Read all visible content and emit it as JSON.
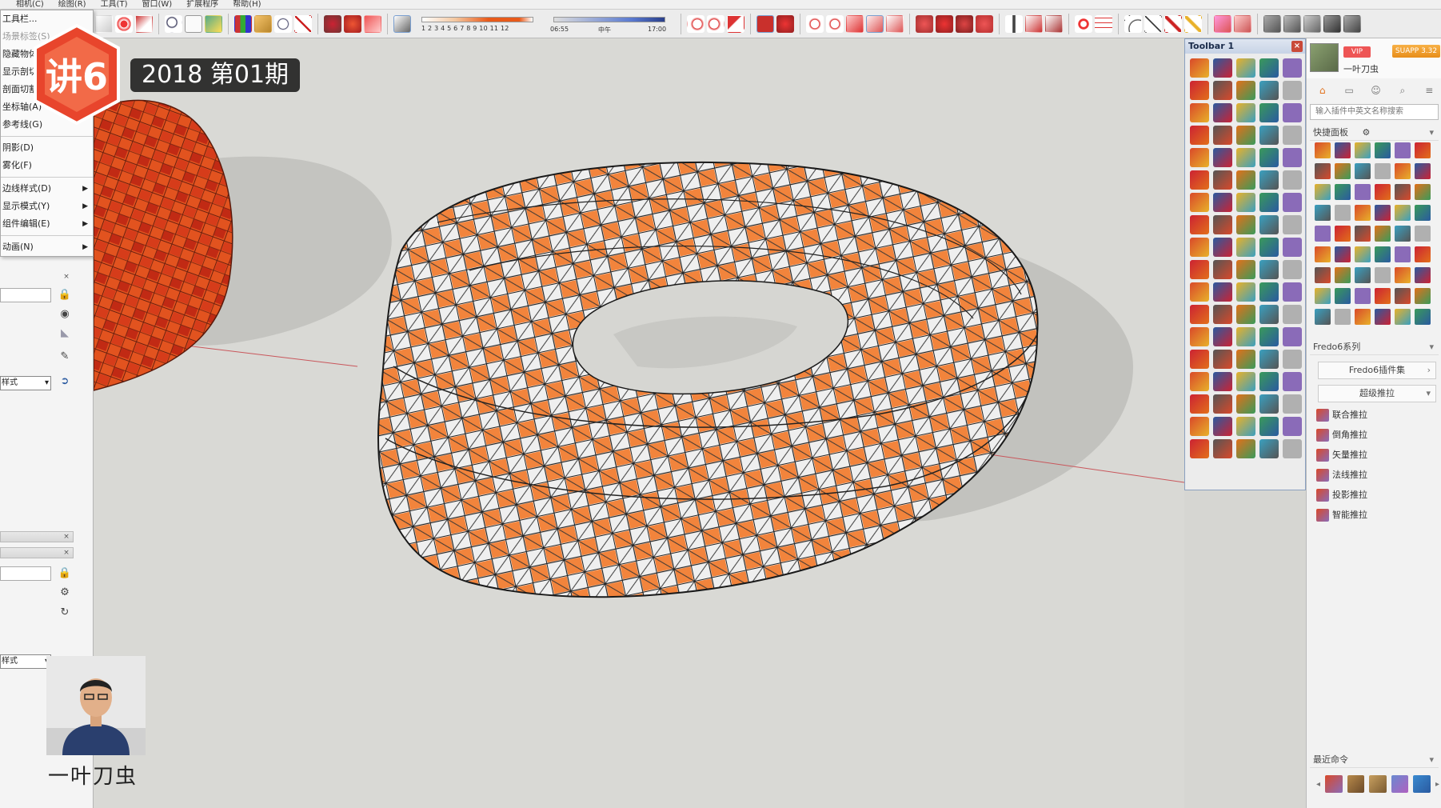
{
  "menubar": {
    "items": [
      "相机(C)",
      "绘图(R)",
      "工具(T)",
      "窗口(W)",
      "扩展程序",
      "帮助(H)"
    ]
  },
  "toolbar": {
    "shadow_months": "1 2 3 4 5 6 7 8 9 10 11 12",
    "shadow_time_start": "06:55",
    "shadow_time_mid": "中午",
    "shadow_time_end": "17:00"
  },
  "view_menu": {
    "items": [
      {
        "label": "工具栏..."
      },
      {
        "label": "场景标签(S)"
      },
      {
        "label": "隐藏物体"
      },
      {
        "label": "显示剖切"
      },
      {
        "label": "剖面切割"
      },
      {
        "label": "坐标轴(A)"
      },
      {
        "label": "参考线(G)"
      },
      {
        "label": "阴影(D)"
      },
      {
        "label": "雾化(F)"
      },
      {
        "label": "边线样式(D)",
        "submenu": true
      },
      {
        "label": "显示模式(Y)",
        "submenu": true
      },
      {
        "label": "组件编辑(E)",
        "submenu": true
      },
      {
        "label": "动画(N)",
        "submenu": true
      }
    ]
  },
  "left_panel": {
    "style_select_1": "样式",
    "style_select_2": "样式"
  },
  "overlay": {
    "logo_text": "讲6",
    "episode": "2018 第01期",
    "presenter_name": "一叶刀虫"
  },
  "toolbar1": {
    "title": "Toolbar 1",
    "close": "×"
  },
  "right_panel": {
    "username": "一叶刀虫",
    "vip": "VIP",
    "version": "SUAPP 3.32",
    "search_placeholder": "输入插件中英文名称搜索",
    "quick_panel_title": "快捷面板",
    "fredo_title": "Fredo6系列",
    "fredo_dropdown": "Fredo6插件集",
    "pushpull_dropdown": "超级推拉",
    "commands": [
      "联合推拉",
      "倒角推拉",
      "矢量推拉",
      "法线推拉",
      "投影推拉",
      "智能推拉"
    ],
    "recent_title": "最近命令"
  },
  "colors": {
    "panel_orange": "#f2843c",
    "panel_red": "#d93a1e",
    "ground": "#d9d9d5"
  }
}
